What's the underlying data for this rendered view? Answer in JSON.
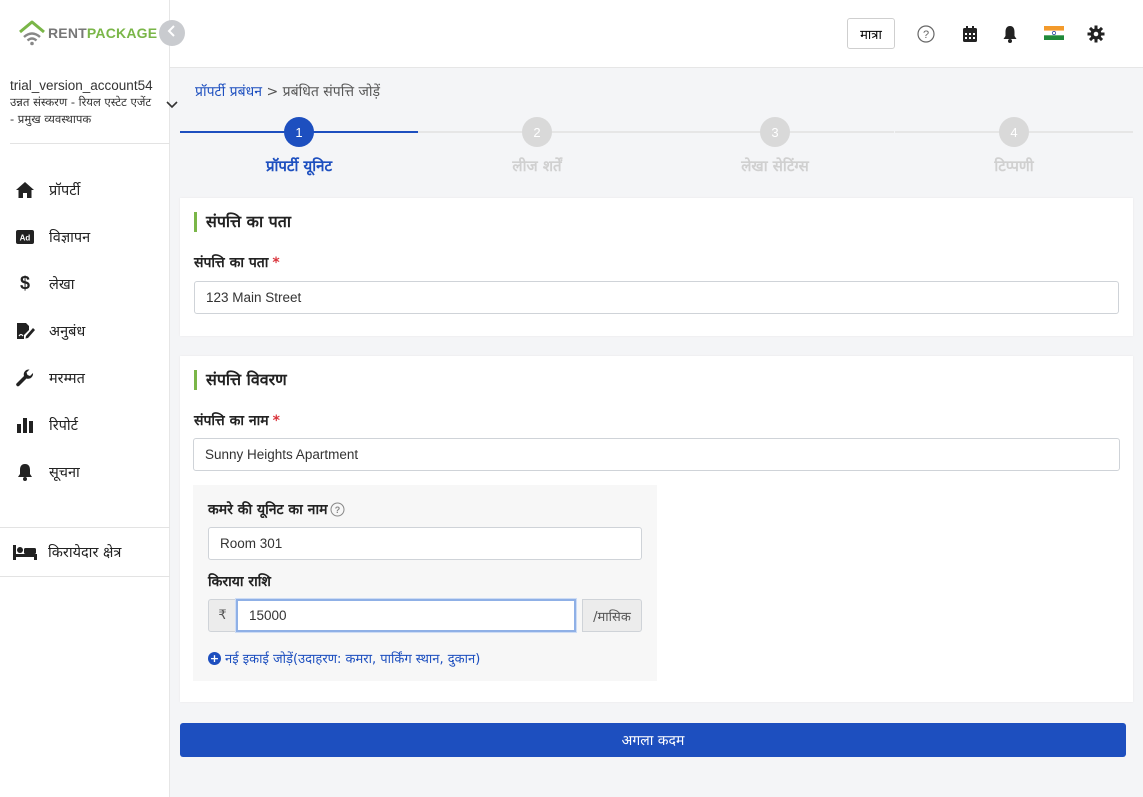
{
  "brand": {
    "part1": "RENT",
    "part2": "PACKAGE",
    "accent": "#7ab648",
    "primary": "#1d4fbf"
  },
  "account": {
    "name": "trial_version_account54",
    "subtitle": "उन्नत संस्करण - रियल एस्टेट एजेंट - प्रमुख व्यवस्थापक"
  },
  "sidebar": {
    "items": [
      {
        "label": "प्रॉपर्टी",
        "icon": "home-icon"
      },
      {
        "label": "विज्ञापन",
        "icon": "ad-icon"
      },
      {
        "label": "लेखा",
        "icon": "dollar-icon"
      },
      {
        "label": "अनुबंध",
        "icon": "contract-icon"
      },
      {
        "label": "मरम्मत",
        "icon": "wrench-icon"
      },
      {
        "label": "रिपोर्ट",
        "icon": "chart-icon"
      },
      {
        "label": "सूचना",
        "icon": "bell-icon"
      }
    ],
    "tenant": {
      "label": "किरायेदार क्षेत्र",
      "icon": "bed-icon"
    }
  },
  "topbar": {
    "lang_label": "मात्रा",
    "icons": [
      "help-icon",
      "calendar-icon",
      "notification-bell-icon",
      "india-flag-icon",
      "gear-icon"
    ]
  },
  "breadcrumb": {
    "parent": "प्रॉपर्टी प्रबंधन",
    "separator": ">",
    "current": "प्रबंधित संपत्ति जोड़ें"
  },
  "steps": [
    {
      "num": "1",
      "label": "प्रॉपर्टी यूनिट",
      "active": true
    },
    {
      "num": "2",
      "label": "लीज शर्तें",
      "active": false
    },
    {
      "num": "3",
      "label": "लेखा सेटिंग्स",
      "active": false
    },
    {
      "num": "4",
      "label": "टिप्पणी",
      "active": false
    }
  ],
  "address_section": {
    "title": "संपत्ति का पता",
    "field_label": "संपत्ति का पता",
    "required": "*",
    "value": "123 Main Street"
  },
  "details_section": {
    "title": "संपत्ति विवरण",
    "name_label": "संपत्ति का नाम",
    "required": "*",
    "name_value": "Sunny Heights Apartment",
    "unit_name_label": "कमरे की यूनिट का नाम",
    "unit_name_value": "Room 301",
    "rent_label": "किराया राशि",
    "currency": "₹",
    "rent_value": "15000",
    "rent_suffix": "/मासिक",
    "add_unit": "नई इकाई जोड़ें(उदाहरण: कमरा, पार्किंग स्थान, दुकान)"
  },
  "next_button": "अगला कदम"
}
